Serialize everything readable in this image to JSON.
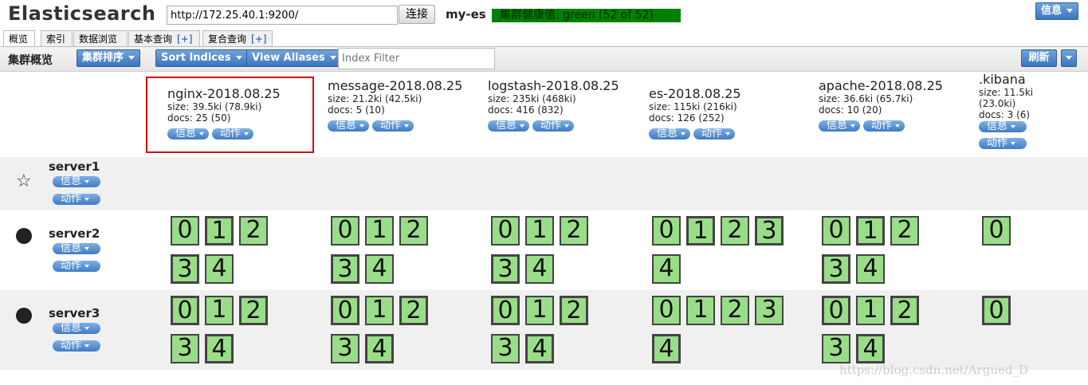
{
  "app": {
    "title": "Elasticsearch"
  },
  "connection": {
    "url": "http://172.25.40.1:9200/",
    "connect_label": "连接"
  },
  "cluster": {
    "name": "my-es",
    "health": "集群健康值: green (52 of 52)",
    "info_label": "信息"
  },
  "tabs": [
    {
      "label": "概览"
    },
    {
      "label": "索引"
    },
    {
      "label": "数据浏览"
    },
    {
      "label": "基本查询",
      "plus": "[+]"
    },
    {
      "label": "复合查询",
      "plus": "[+]"
    }
  ],
  "toolbar": {
    "overview_title": "集群概览",
    "sort_cluster": "集群排序",
    "sort_indices": "Sort Indices",
    "view_aliases": "View Aliases",
    "filter_placeholder": "Index Filter",
    "refresh": "刷新"
  },
  "actions": {
    "info": "信息",
    "action": "动作"
  },
  "indices": [
    {
      "name": "nginx-2018.08.25",
      "size": "size: 39.5ki (78.9ki)",
      "docs": "docs: 25 (50)"
    },
    {
      "name": "message-2018.08.25",
      "size": "size: 21.2ki (42.5ki)",
      "docs": "docs: 5 (10)"
    },
    {
      "name": "logstash-2018.08.25",
      "size": "size: 235ki (468ki)",
      "docs": "docs: 416 (832)"
    },
    {
      "name": "es-2018.08.25",
      "size": "size: 115ki (216ki)",
      "docs": "docs: 126 (252)"
    },
    {
      "name": "apache-2018.08.25",
      "size": "size: 36.6ki (65.7ki)",
      "docs": "docs: 10 (20)"
    },
    {
      "name": ".kibana",
      "size": "size: 11.5ki (23.0ki)",
      "docs": "docs: 3 (6)"
    }
  ],
  "servers": [
    {
      "name": "server1",
      "icon": "star-icon"
    },
    {
      "name": "server2",
      "icon": "dot-icon"
    },
    {
      "name": "server3",
      "icon": "dot-icon"
    }
  ],
  "shards": [
    {
      "server": "server2",
      "indices": [
        [
          "0",
          "1",
          "2",
          "3",
          "4"
        ],
        [
          "0",
          "1",
          "2",
          "3",
          "4"
        ],
        [
          "0",
          "1",
          "2",
          "3",
          "4"
        ],
        [
          "0",
          "1",
          "2",
          "3",
          "4"
        ],
        [
          "0",
          "1",
          "2",
          "3",
          "4"
        ],
        [
          "0"
        ]
      ]
    },
    {
      "server": "server3",
      "indices": [
        [
          "0",
          "1",
          "2",
          "3",
          "4"
        ],
        [
          "0",
          "1",
          "2",
          "3",
          "4"
        ],
        [
          "0",
          "1",
          "2",
          "3",
          "4"
        ],
        [
          "0",
          "1",
          "2",
          "3",
          "4"
        ],
        [
          "0",
          "1",
          "2",
          "3",
          "4"
        ],
        [
          "0"
        ]
      ]
    }
  ],
  "watermark": "https://blog.csdn.net/Argued_D",
  "colors": {
    "health_green": "#008000",
    "shard_fill": "#99dd88",
    "button_blue": "#3f7cc5",
    "highlight": "#d01010"
  }
}
